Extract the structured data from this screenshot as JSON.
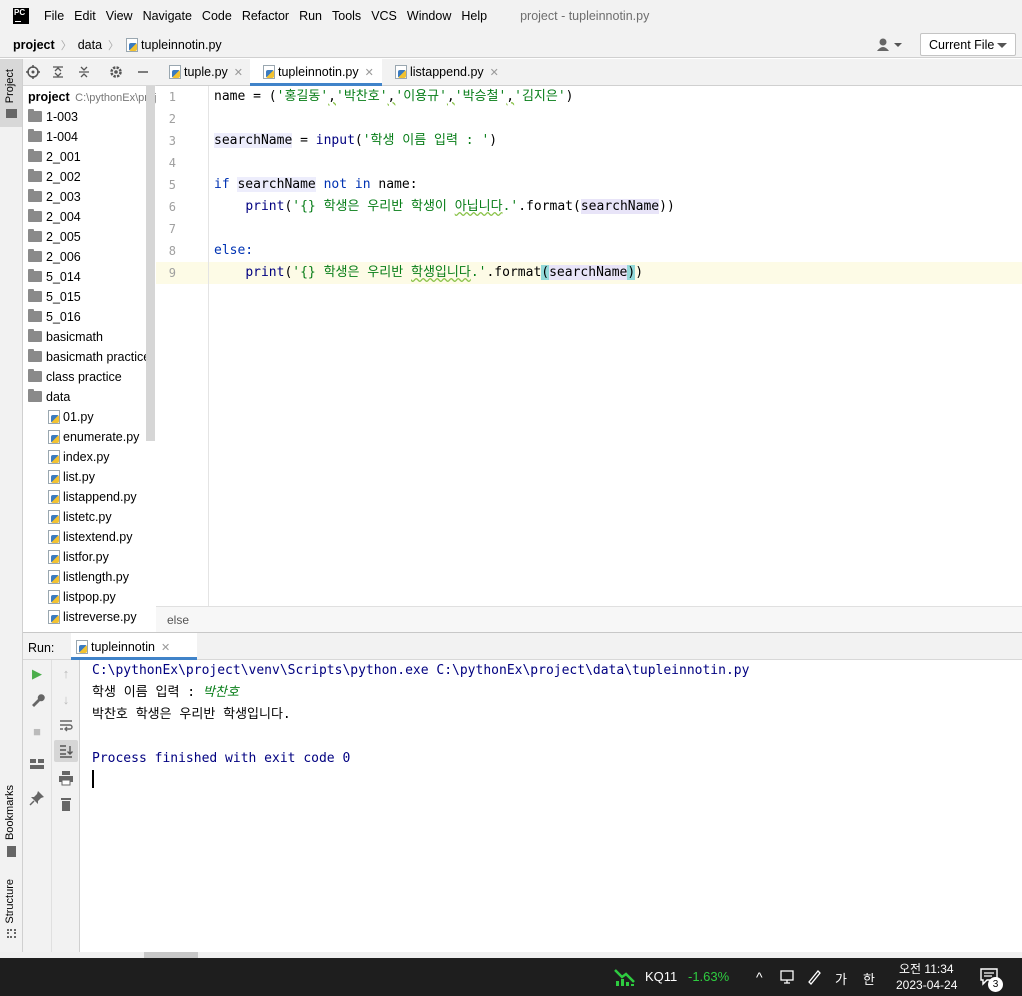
{
  "menubar": {
    "items": [
      "File",
      "Edit",
      "View",
      "Navigate",
      "Code",
      "Refactor",
      "Run",
      "Tools",
      "VCS",
      "Window",
      "Help"
    ],
    "window_title": "project - tupleinnotin.py"
  },
  "navbar": {
    "crumbs": [
      "project",
      "data",
      "tupleinnotin.py"
    ],
    "run_config": "Current File"
  },
  "leftstrip": {
    "project": "Project",
    "bookmarks": "Bookmarks",
    "structure": "Structure"
  },
  "project_tree": {
    "root_name": "project",
    "root_path": "C:\\pythonEx\\project",
    "folders": [
      "1-003",
      "1-004",
      "2_001",
      "2_002",
      "2_003",
      "2_004",
      "2_005",
      "2_006",
      "5_014",
      "5_015",
      "5_016",
      "basicmath",
      "basicmath practice",
      "class practice",
      "data"
    ],
    "files": [
      "01.py",
      "enumerate.py",
      "index.py",
      "list.py",
      "listappend.py",
      "listetc.py",
      "listextend.py",
      "listfor.py",
      "listlength.py",
      "listpop.py",
      "listreverse.py"
    ]
  },
  "editor_tabs": [
    {
      "label": "tuple.py"
    },
    {
      "label": "tupleinnotin.py"
    },
    {
      "label": "listappend.py"
    }
  ],
  "code": {
    "line_numbers": [
      "1",
      "2",
      "3",
      "4",
      "5",
      "6",
      "7",
      "8",
      "9"
    ],
    "l1_a": "name = (",
    "l1_s1": "'홍길동'",
    "l1_c1": ",",
    "l1_s2": "'박찬호'",
    "l1_c2": ",",
    "l1_s3": "'이용규'",
    "l1_c3": ",",
    "l1_s4": "'박승철'",
    "l1_c4": ",",
    "l1_s5": "'김지은'",
    "l1_b": ")",
    "l3_var": "searchName",
    "l3_eq": " = ",
    "l3_fn": "input",
    "l3_op": "(",
    "l3_str": "'학생 이름 입력 : '",
    "l3_cl": ")",
    "l5_if": "if",
    "l5_var": "searchName",
    "l5_notin": "not in",
    "l5_rest": " name:",
    "l6_fn": "print",
    "l6_op": "(",
    "l6_str_a": "'{} 학생은 우리반 학생이 ",
    "l6_str_b": "아닙니다",
    "l6_str_c": ".'",
    "l6_fmt": ".format(",
    "l6_var": "searchName",
    "l6_cl": "))",
    "l8_else": "else:",
    "l9_fn": "print",
    "l9_op": "(",
    "l9_str_a": "'{} 학생은 우리반 ",
    "l9_str_b": "학생입니다",
    "l9_str_c": ".'",
    "l9_fmt": ".format",
    "l9_b1": "(",
    "l9_var": "searchName",
    "l9_b2": ")",
    "l9_cl": ")"
  },
  "editor_breadcrumb": "else",
  "run_panel": {
    "label": "Run:",
    "tab": "tupleinnotin",
    "lines": {
      "cmd": "C:\\pythonEx\\project\\venv\\Scripts\\python.exe C:\\pythonEx\\project\\data\\tupleinnotin.py",
      "prompt": "학생 이름 입력 : ",
      "input": "박찬호",
      "out": "박찬호 학생은 우리반 학생입니다.",
      "finished": "Process finished with exit code 0"
    }
  },
  "taskbar": {
    "ticker": "KQ11",
    "change": "-1.63%",
    "ime_ga": "가",
    "ime_han": "한",
    "time": "오전 11:34",
    "date": "2023-04-24",
    "notif_count": "3",
    "change_color": "#2ecc40"
  }
}
